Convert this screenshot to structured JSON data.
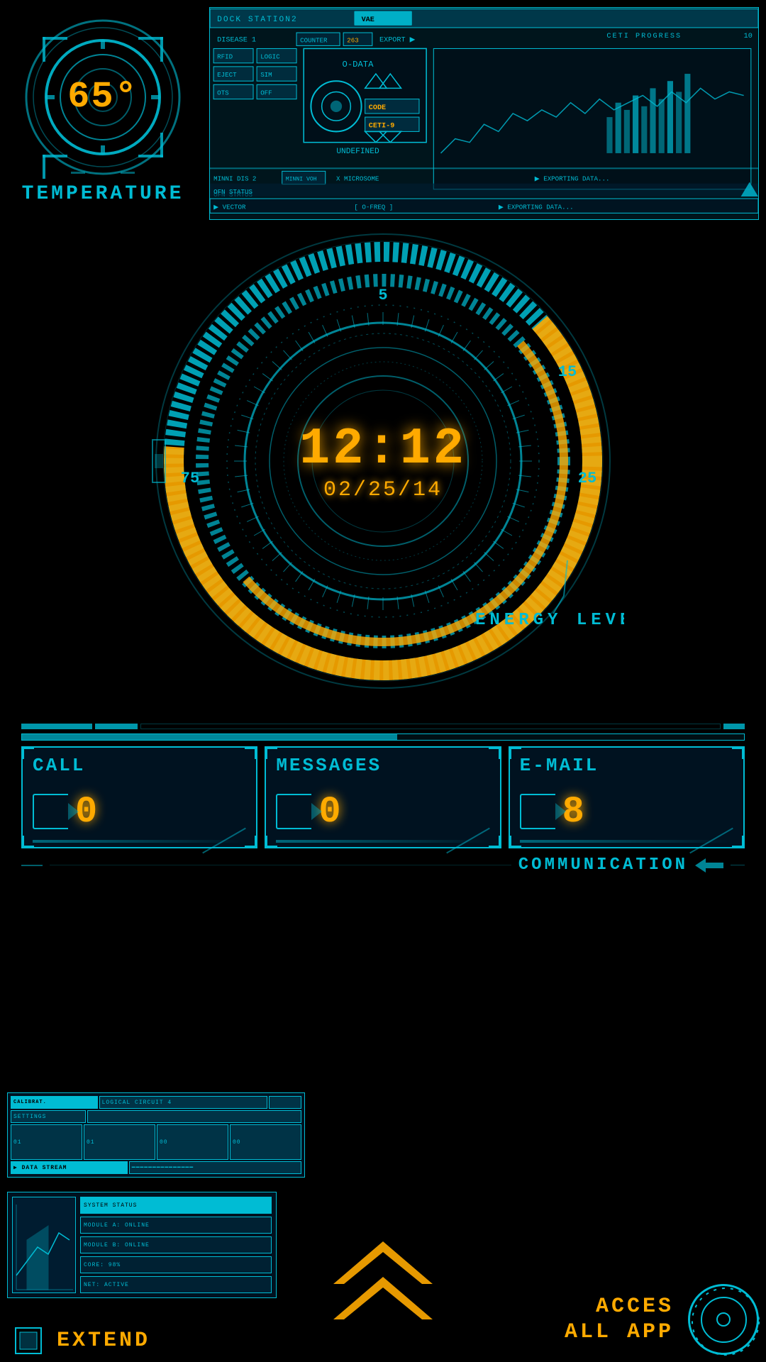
{
  "top": {
    "temperature": {
      "value": "65°",
      "label": "TEMPERATURE"
    },
    "hud": {
      "station_label": "DOCK STATION2",
      "disease_label": "DISEASE 1",
      "counter_label": "COUNTER",
      "export_label": "EXPORT",
      "ceti_progress": "CETI PROGRESS",
      "rfid": "RFID",
      "logic": "LOGIC",
      "eject": "EJECT",
      "sim": "SIM",
      "ots": "OTS",
      "off": "OFF",
      "code": "CODE",
      "ceti9": "CETI-9",
      "undefined": "UNDEFINED",
      "vector": "VECTOR",
      "o_data": "O-DATA",
      "o_freq": "O-FREQ",
      "status": "STATUS",
      "exporting": "EXPORTING DATA..."
    }
  },
  "clock": {
    "time": "12:12",
    "date": "02/25/14",
    "energy_label": "ENERGY LEVEL",
    "scale_5": "5",
    "scale_15": "15",
    "scale_25": "25",
    "scale_75": "75"
  },
  "communication": {
    "label": "COMMUNICATION",
    "call": {
      "title": "CALL",
      "count": "0"
    },
    "messages": {
      "title": "MESSAGES",
      "count": "0"
    },
    "email": {
      "title": "E-MAIL",
      "count": "8"
    }
  },
  "bottom": {
    "extend_label": "EXTEND",
    "access_label": "ACCES\nALL APP",
    "mini_hud": {
      "row1": [
        "CALIBRAT.",
        "LOGICAL CIRCUIT 4",
        ""
      ],
      "row2": [
        "SETTINGS",
        ""
      ],
      "row3": [
        "01",
        "01",
        "00"
      ]
    }
  }
}
